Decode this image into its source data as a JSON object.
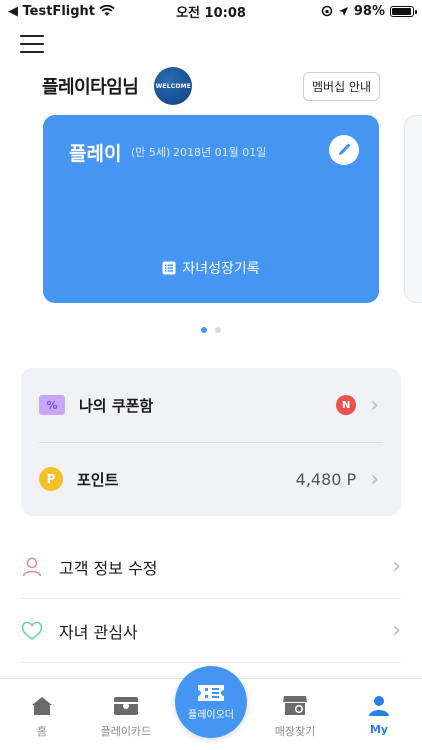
{
  "status_bar": {
    "carrier": "◀ TestFlight",
    "time": "오전 10:08",
    "battery": "98%"
  },
  "profile": {
    "name": "플레이타임님",
    "badge_text": "WELCOME",
    "membership_button": "멤버십 안내"
  },
  "card": {
    "child_name": "플레이",
    "age": "(만 5세)",
    "birth_date": "2018년 01월 01일",
    "growth_link": "자녀성장기록"
  },
  "carousel": {
    "pages": 2,
    "active_index": 0
  },
  "panel": {
    "coupon": {
      "label": "나의 쿠폰함",
      "icon_text": "%",
      "badge": "N"
    },
    "point": {
      "label": "포인트",
      "icon_text": "P",
      "value": "4,480 P"
    }
  },
  "menu_list": [
    {
      "label": "고객 정보 수정"
    },
    {
      "label": "자녀 관심사"
    }
  ],
  "tab_bar": {
    "home": "홈",
    "play_card": "플레이카드",
    "play_order": "플레이오더",
    "store_finder": "매장찾기",
    "my": "My"
  },
  "colors": {
    "accent": "#4596f3",
    "badge_red": "#e9534f",
    "point_yellow": "#f5c12a",
    "coupon_purple": "#c6a8f6"
  },
  "icons": [
    "wifi-icon",
    "location-icon",
    "pencil-icon",
    "list-icon",
    "coupon-icon",
    "point-icon",
    "person-icon",
    "heart-icon",
    "home-icon",
    "card-icon",
    "ticket-icon",
    "store-icon",
    "user-icon"
  ]
}
